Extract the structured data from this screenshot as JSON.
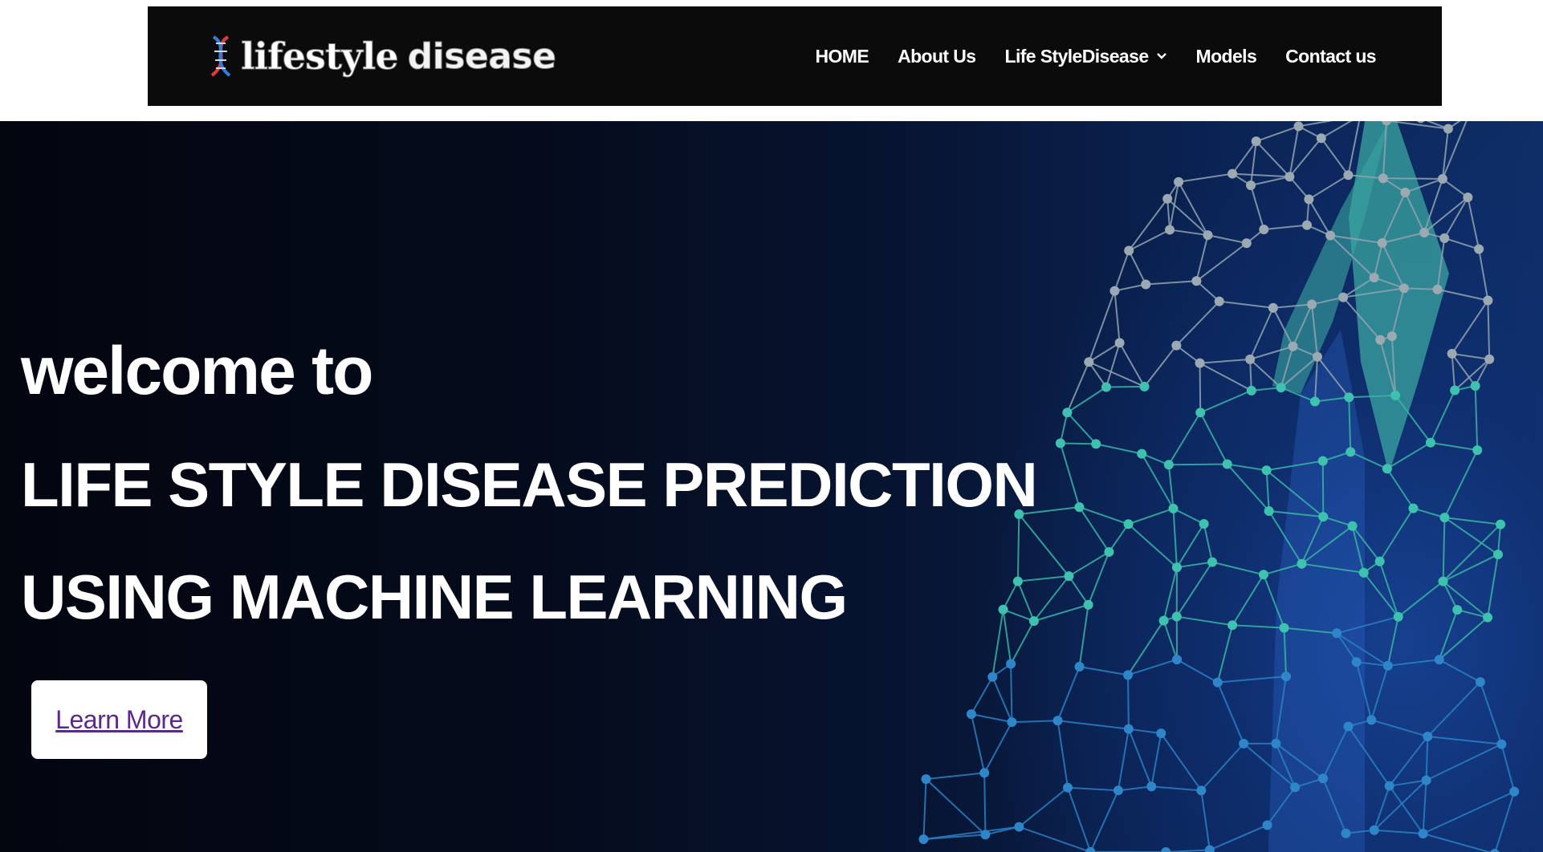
{
  "header": {
    "logo_word1": "lifestyle",
    "logo_word2": "disease",
    "nav": [
      {
        "label": "HOME"
      },
      {
        "label": "About Us"
      },
      {
        "label": "Life StyleDisease"
      },
      {
        "label": "Models"
      },
      {
        "label": "Contact us"
      }
    ]
  },
  "hero": {
    "welcome": "welcome to",
    "title_line1": "LIFE STYLE DISEASE PREDICTION",
    "title_line2": "USING MACHINE LEARNING",
    "cta_label": "Learn More"
  },
  "colors": {
    "navbar_bg": "#0b0b0b",
    "hero_bg_dark": "#03060f",
    "hero_bg_blue": "#16408f",
    "mesh_teal": "#3fc1b0",
    "cta_text": "#5a2a86"
  },
  "icons": {
    "logo": "dna-icon",
    "dropdown": "chevron-down-icon"
  }
}
